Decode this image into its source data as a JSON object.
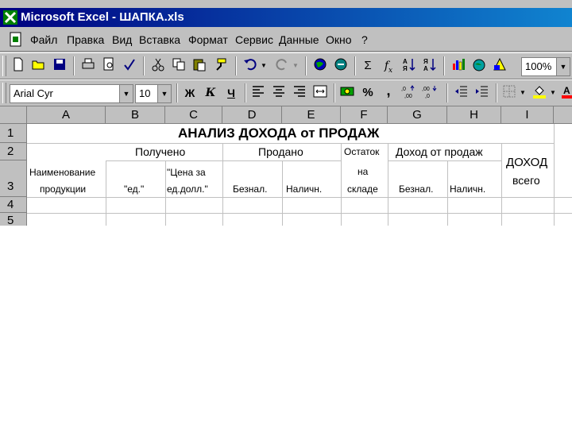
{
  "window": {
    "title": "Microsoft Excel - ШАПКА.xls"
  },
  "menu": {
    "items": [
      "Файл",
      "Правка",
      "Вид",
      "Вставка",
      "Формат",
      "Сервис",
      "Данные",
      "Окно",
      "?"
    ]
  },
  "toolbar": {
    "sum_glyph": "Σ",
    "fx_glyph": "f",
    "fx_sub": "x",
    "zoom": "100%",
    "font": "Arial Cyr",
    "size": "10",
    "bold": "Ж",
    "italic": "К",
    "underline": "Ч",
    "percent": "%",
    "comma": ","
  },
  "sheet": {
    "columns": [
      "A",
      "B",
      "C",
      "D",
      "E",
      "F",
      "G",
      "H",
      "I"
    ],
    "rows": [
      "1",
      "2",
      "3",
      "4",
      "5"
    ],
    "title": "АНАЛИЗ ДОХОДА от ПРОДАЖ",
    "h_received": "Получено",
    "h_sold": "Продано",
    "h_stock_1": "Остаток",
    "h_stock_2": "на",
    "h_stock_3": "складе",
    "h_income": "Доход от продаж",
    "h_total_1": "ДОХОД",
    "h_total_2": "всего",
    "h_product_1": "Наименование",
    "h_product_2": "продукции",
    "h_units": "\"ед.\"",
    "h_price_1": "\"Цена за",
    "h_price_2": "ед.долл.\"",
    "h_cashless_d": "Безнал.",
    "h_cash_e": "Наличн.",
    "h_cashless_g": "Безнал.",
    "h_cash_h": "Наличн."
  }
}
